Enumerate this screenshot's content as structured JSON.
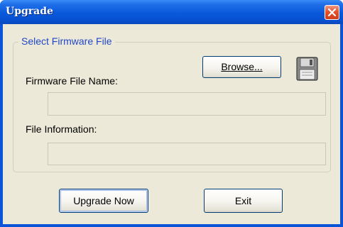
{
  "window": {
    "title": "Upgrade"
  },
  "group": {
    "legend": "Select Firmware File"
  },
  "firmware": {
    "label": "Firmware File Name:",
    "value": "",
    "browse_label": "Browse..."
  },
  "info": {
    "label": "File Information:",
    "value": ""
  },
  "actions": {
    "upgrade_label": "Upgrade Now",
    "exit_label": "Exit"
  },
  "icons": {
    "close": "close-icon",
    "disk": "floppy-disk-icon"
  }
}
